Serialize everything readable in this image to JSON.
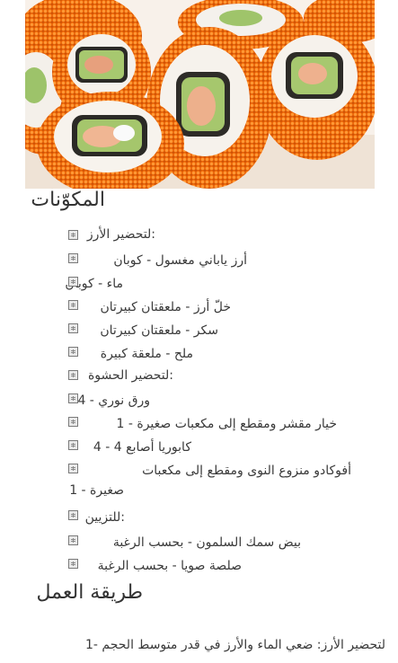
{
  "hero": {
    "image_alt": "sushi-rolls-photo"
  },
  "ingredients": {
    "title": "المكوّنات",
    "items": [
      {
        "label": ":لتحضير الأرز",
        "icon": "image-placeholder-icon"
      },
      {
        "label": "أرز ياباني مغسول - كوبان",
        "icon": "image-placeholder-icon"
      },
      {
        "label": "ماء - كوبان",
        "icon": "image-placeholder-icon"
      },
      {
        "label": "خلّ أرز - ملعقتان كبيرتان",
        "icon": "image-placeholder-icon"
      },
      {
        "label": "سكر - ملعقتان كبيرتان",
        "icon": "image-placeholder-icon"
      },
      {
        "label": "ملح - ملعقة كبيرة",
        "icon": "image-placeholder-icon"
      },
      {
        "label": ":لتحضير الحشوة",
        "icon": "image-placeholder-icon"
      },
      {
        "label": "ورق نوري - 4",
        "icon": "image-placeholder-icon"
      },
      {
        "label": "خيار مقشر ومقطع إلى مكعبات صغيرة - 1",
        "icon": "image-placeholder-icon"
      },
      {
        "label": "كابوريا أصابع 4 - 4",
        "icon": "image-placeholder-icon"
      },
      {
        "label": "أفوكادو منزوع النوى ومقطع إلى مكعبات",
        "label2": "صغيرة - 1",
        "icon": "image-placeholder-icon"
      },
      {
        "label": ":للتزيين",
        "icon": "image-placeholder-icon"
      },
      {
        "label": "بيض سمك السلمون - بحسب الرغبة",
        "icon": "image-placeholder-icon"
      },
      {
        "label": "صلصة صويا - بحسب الرغبة",
        "icon": "image-placeholder-icon"
      }
    ]
  },
  "method": {
    "title": "طريقة العمل",
    "step1": "لتحضير الأرز: ضعي الماء والأرز في قدر متوسط الحجم -1"
  }
}
